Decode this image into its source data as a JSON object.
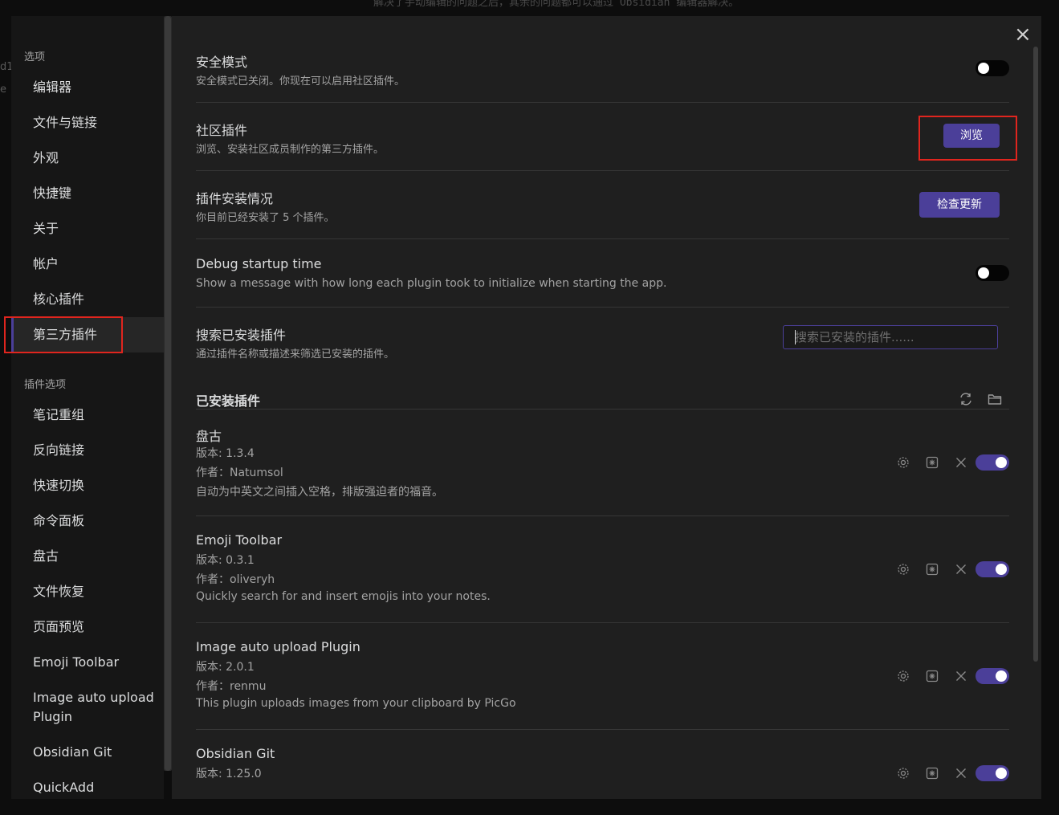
{
  "background": {
    "top_text": "解决了手动编辑的问题之后，其余的问题都可以通过 Obsidian 编辑器解决。",
    "left_fragment_1": "d1",
    "left_fragment_2": "e"
  },
  "sidebar": {
    "options_heading": "选项",
    "options_items": [
      {
        "label": "编辑器"
      },
      {
        "label": "文件与链接"
      },
      {
        "label": "外观"
      },
      {
        "label": "快捷键"
      },
      {
        "label": "关于"
      },
      {
        "label": "帐户"
      },
      {
        "label": "核心插件"
      },
      {
        "label": "第三方插件",
        "active": true
      }
    ],
    "plugin_options_heading": "插件选项",
    "plugin_items": [
      {
        "label": "笔记重组"
      },
      {
        "label": "反向链接"
      },
      {
        "label": "快速切换"
      },
      {
        "label": "命令面板"
      },
      {
        "label": "盘古"
      },
      {
        "label": "文件恢复"
      },
      {
        "label": "页面预览"
      },
      {
        "label": "Emoji Toolbar"
      },
      {
        "label": "Image auto upload Plugin"
      },
      {
        "label": "Obsidian Git"
      },
      {
        "label": "QuickAdd"
      }
    ]
  },
  "settings": {
    "safe_mode": {
      "name": "安全模式",
      "desc": "安全模式已关闭。你现在可以启用社区插件。",
      "enabled": false
    },
    "community": {
      "name": "社区插件",
      "desc": "浏览、安装社区成员制作的第三方插件。",
      "button": "浏览"
    },
    "install_status": {
      "name": "插件安装情况",
      "desc": "你目前已经安装了 5 个插件。",
      "button": "检查更新"
    },
    "debug_startup": {
      "name": "Debug startup time",
      "desc": "Show a message with how long each plugin took to initialize when starting the app.",
      "enabled": false
    },
    "search_installed": {
      "name": "搜索已安装插件",
      "desc": "通过插件名称或描述来筛选已安装的插件。",
      "placeholder": "搜索已安装的插件......"
    }
  },
  "installed": {
    "title": "已安装插件",
    "plugins": [
      {
        "name": "盘古",
        "version": "版本: 1.3.4",
        "author": "作者：Natumsol",
        "desc": "自动为中英文之间插入空格，排版强迫者的福音。",
        "enabled": true
      },
      {
        "name": "Emoji Toolbar",
        "version": "版本: 0.3.1",
        "author": "作者：oliveryh",
        "desc": "Quickly search for and insert emojis into your notes.",
        "enabled": true
      },
      {
        "name": "Image auto upload Plugin",
        "version": "版本: 2.0.1",
        "author": "作者：renmu",
        "desc": "This plugin uploads images from your clipboard by PicGo",
        "enabled": true
      },
      {
        "name": "Obsidian Git",
        "version": "版本: 1.25.0",
        "author": "",
        "desc": "",
        "enabled": true
      }
    ]
  },
  "colors": {
    "accent": "#4b3f99",
    "highlight_box": "#e0251e",
    "panel_bg": "#1f1f1f",
    "sidebar_bg": "#161616"
  },
  "icons": {
    "close": "close-icon",
    "reload": "reload-icon",
    "folder": "folder-icon",
    "settings": "gear-icon",
    "hotkey": "hotkey-icon",
    "uninstall": "x-icon"
  }
}
